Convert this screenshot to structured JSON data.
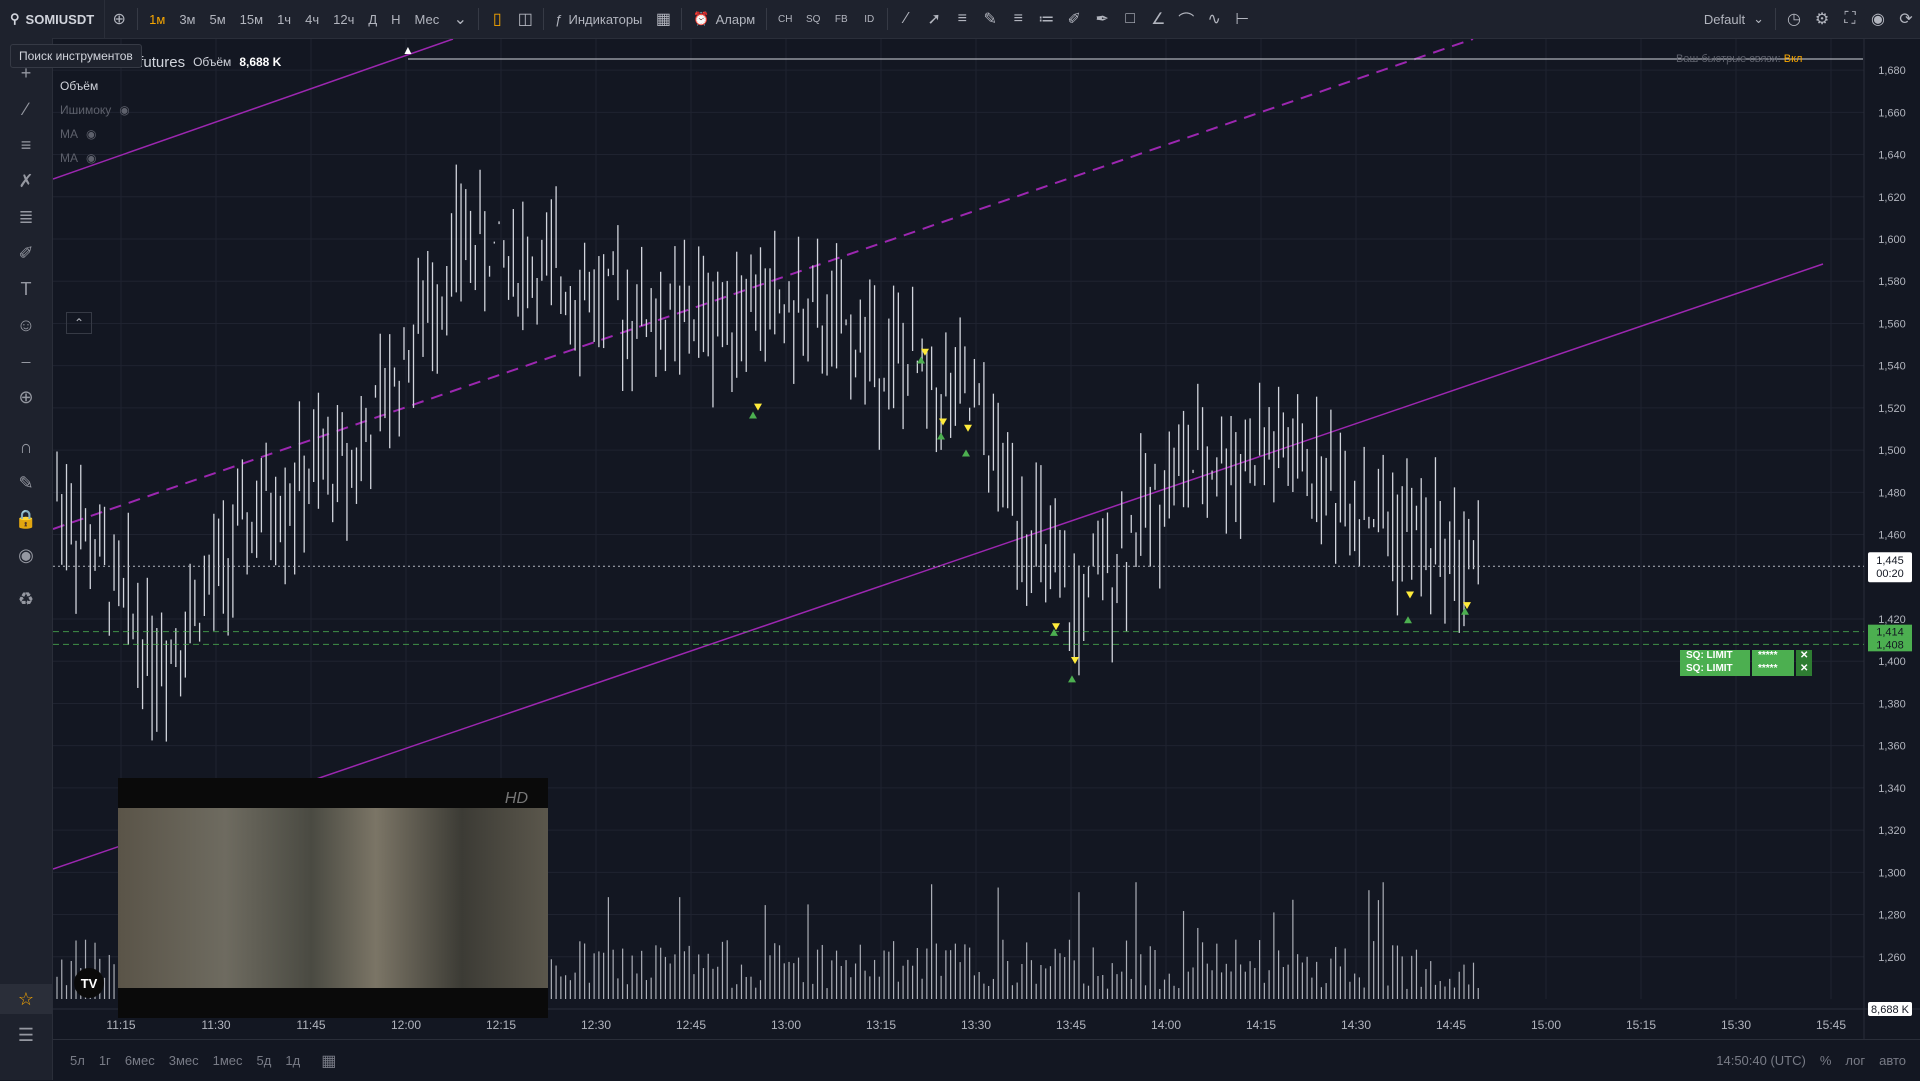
{
  "toolbar": {
    "symbol": "SOMIUSDT",
    "timeframes": [
      "1м",
      "3м",
      "5м",
      "15м",
      "1ч",
      "4ч",
      "12ч",
      "Д",
      "Н",
      "Мес"
    ],
    "active_timeframe": "1м",
    "indicators_label": "Индикаторы",
    "alert_label": "Аларм",
    "layout_label": "Default"
  },
  "tooltip": "Поиск инструментов",
  "legend": {
    "title": "1 · binance-futures",
    "volume_label": "Объём",
    "volume_value": "8,688 K",
    "indicators": [
      "Объём",
      "Ишимоку",
      "MA",
      "MA"
    ]
  },
  "scale_note": {
    "text": "Ваш быстрые связи:",
    "link": "Вкл"
  },
  "price_axis": {
    "ticks": [
      "1,680",
      "1,660",
      "1,640",
      "1,620",
      "1,600",
      "1,580",
      "1,560",
      "1,540",
      "1,520",
      "1,500",
      "1,480",
      "1,460",
      "1,420",
      "1,400",
      "1,380",
      "1,360",
      "1,340",
      "1,320",
      "1,300",
      "1,280",
      "1,260"
    ],
    "current_price": "1,445",
    "countdown": "00:20",
    "volume_tag": "8,688 K"
  },
  "orders": [
    {
      "label": "SQ: LIMIT",
      "qty": "*****",
      "price": "1,414"
    },
    {
      "label": "SQ: LIMIT",
      "qty": "*****",
      "price": "1,408"
    }
  ],
  "time_axis": {
    "ticks": [
      "11:15",
      "11:30",
      "11:45",
      "12:00",
      "12:15",
      "12:30",
      "12:45",
      "13:00",
      "13:15",
      "13:30",
      "13:45",
      "14:00",
      "14:15",
      "14:30",
      "14:45",
      "15:00",
      "15:15",
      "15:30",
      "15:45"
    ]
  },
  "bottom": {
    "ranges": [
      "5л",
      "1г",
      "6мес",
      "3мес",
      "1мес",
      "5д",
      "1д"
    ],
    "clock": "14:50:40 (UTC)",
    "percent": "%",
    "log": "лог",
    "auto": "авто"
  },
  "video": {
    "badge": "HD",
    "logo": "TV"
  },
  "chart_data": {
    "type": "ohlc",
    "price_range": [
      1.24,
      1.69
    ],
    "x": [
      "11:15",
      "11:30",
      "11:45",
      "12:00",
      "12:15",
      "12:30",
      "12:45",
      "13:00",
      "13:15",
      "13:30",
      "13:45",
      "14:00",
      "14:15",
      "14:30",
      "14:45"
    ],
    "close": [
      1.48,
      1.4,
      1.47,
      1.5,
      1.6,
      1.58,
      1.56,
      1.57,
      1.55,
      1.52,
      1.42,
      1.49,
      1.5,
      1.47,
      1.445
    ],
    "volume_max_label": "8,688 K",
    "colors": {
      "bars": "#d1d4dc",
      "channel": "#9c27b0",
      "buy_signal": "#4caf50",
      "sell_signal": "#ffeb3b"
    }
  }
}
